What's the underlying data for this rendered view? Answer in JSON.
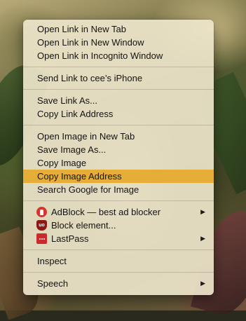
{
  "context_menu": {
    "group_links": [
      {
        "label": "Open Link in New Tab"
      },
      {
        "label": "Open Link in New Window"
      },
      {
        "label": "Open Link in Incognito Window"
      }
    ],
    "group_send": [
      {
        "label": "Send Link to cee’s iPhone"
      }
    ],
    "group_save_link": [
      {
        "label": "Save Link As..."
      },
      {
        "label": "Copy Link Address"
      }
    ],
    "group_image": [
      {
        "label": "Open Image in New Tab"
      },
      {
        "label": "Save Image As..."
      },
      {
        "label": "Copy Image"
      },
      {
        "label": "Copy Image Address",
        "highlighted": true
      },
      {
        "label": "Search Google for Image"
      }
    ],
    "group_extensions": [
      {
        "label": "AdBlock — best ad blocker",
        "icon": "adblock-icon",
        "submenu": true
      },
      {
        "label": "Block element...",
        "icon": "ublock-icon",
        "icon_text": "uo",
        "submenu": false
      },
      {
        "label": "LastPass",
        "icon": "lastpass-icon",
        "submenu": true
      }
    ],
    "group_inspect": [
      {
        "label": "Inspect"
      }
    ],
    "group_speech": [
      {
        "label": "Speech",
        "submenu": true
      }
    ],
    "submenu_arrow": "▶",
    "highlight_color": "#e6ad37"
  }
}
